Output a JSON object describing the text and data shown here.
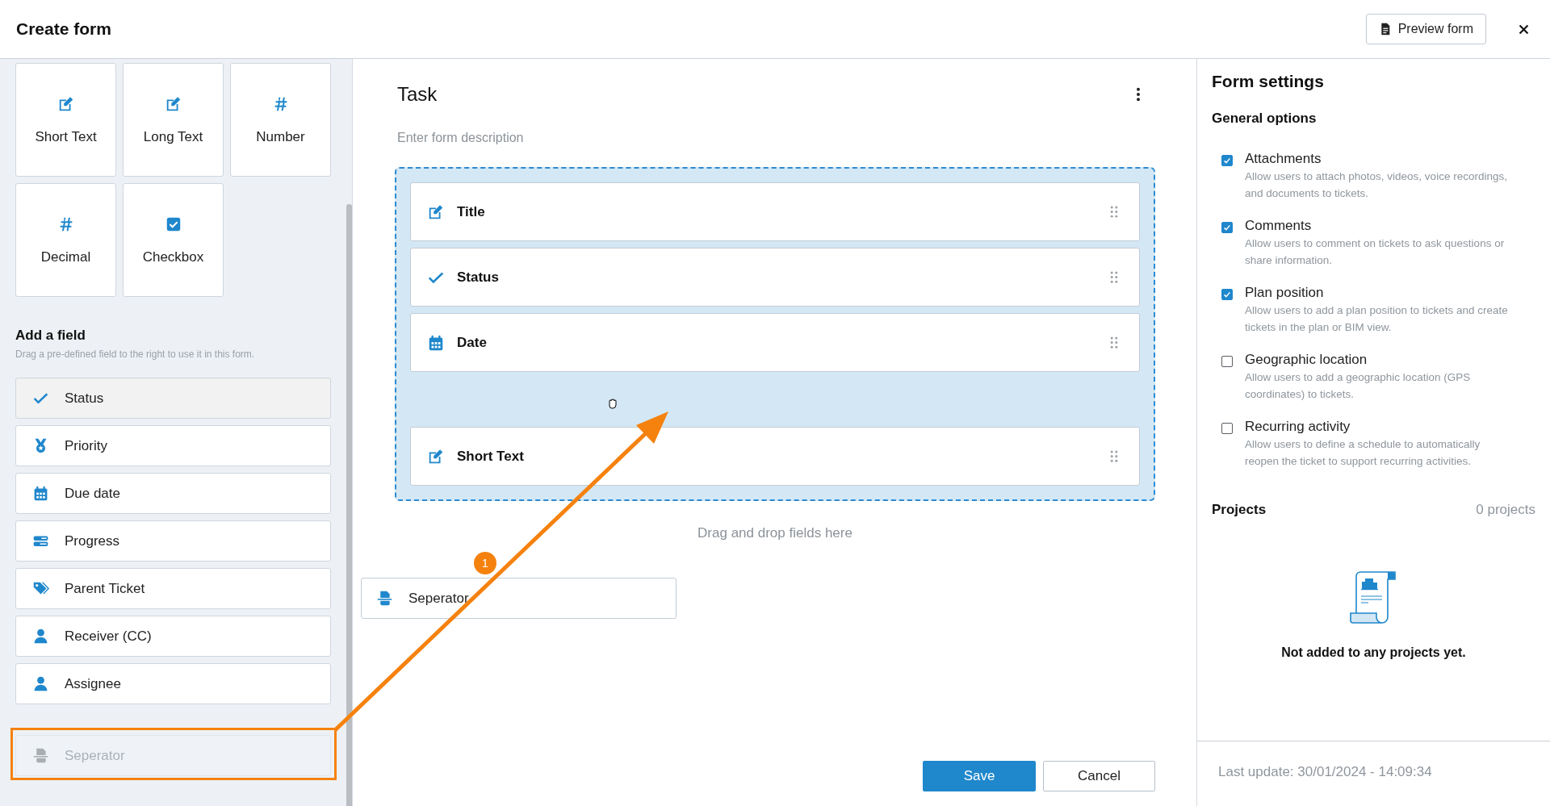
{
  "header": {
    "title": "Create form",
    "preview_button": "Preview form"
  },
  "left": {
    "tiles": [
      {
        "label": "Short Text",
        "kind": "short_text"
      },
      {
        "label": "Long Text",
        "kind": "long_text"
      },
      {
        "label": "Number",
        "kind": "number"
      },
      {
        "label": "Decimal",
        "kind": "decimal"
      },
      {
        "label": "Checkbox",
        "kind": "checkbox"
      }
    ],
    "add_field_title": "Add a field",
    "add_field_hint": "Drag a pre-defined field to the right to use it in this form.",
    "fields": [
      {
        "label": "Status",
        "kind": "status",
        "selected": true,
        "dragging": false
      },
      {
        "label": "Priority",
        "kind": "priority",
        "selected": false,
        "dragging": false
      },
      {
        "label": "Due date",
        "kind": "date",
        "selected": false,
        "dragging": false
      },
      {
        "label": "Progress",
        "kind": "progress",
        "selected": false,
        "dragging": false
      },
      {
        "label": "Parent Ticket",
        "kind": "ticket",
        "selected": false,
        "dragging": false
      },
      {
        "label": "Receiver (CC)",
        "kind": "person",
        "selected": false,
        "dragging": false
      },
      {
        "label": "Assignee",
        "kind": "person",
        "selected": false,
        "dragging": false
      },
      {
        "label": "Seperator",
        "kind": "separator",
        "selected": false,
        "dragging": true
      }
    ]
  },
  "form": {
    "title": "Task",
    "description_placeholder": "Enter form description",
    "fields": [
      {
        "label": "Title",
        "kind": "short_text",
        "drop_target_before": false
      },
      {
        "label": "Status",
        "kind": "status",
        "drop_target_before": false
      },
      {
        "label": "Date",
        "kind": "date",
        "drop_target_before": false
      },
      {
        "label": "Short Text",
        "kind": "short_text",
        "drop_target_before": true
      }
    ],
    "drop_hint": "Drag and drop fields here",
    "dragged_item": {
      "label": "Seperator",
      "kind": "separator"
    },
    "step_badge": "1",
    "save_button": "Save",
    "cancel_button": "Cancel"
  },
  "settings": {
    "title": "Form settings",
    "general_options_title": "General options",
    "options": [
      {
        "label": "Attachments",
        "description": "Allow users to attach photos, videos, voice recordings, and documents to tickets.",
        "checked": true
      },
      {
        "label": "Comments",
        "description": "Allow users to comment on tickets to ask questions or share information.",
        "checked": true
      },
      {
        "label": "Plan position",
        "description": "Allow users to add a plan position to tickets and create tickets in the plan or BIM view.",
        "checked": true
      },
      {
        "label": "Geographic location",
        "description": "Allow users to add a geographic location (GPS coordinates) to tickets.",
        "checked": false
      },
      {
        "label": "Recurring activity",
        "description": "Allow users to define a schedule to automatically reopen the ticket to support recurring activities.",
        "checked": false
      }
    ],
    "projects_title": "Projects",
    "projects_count": "0 projects",
    "projects_empty": "Not added to any projects yet.",
    "last_update": "Last update: 30/01/2024 - 14:09:34"
  }
}
